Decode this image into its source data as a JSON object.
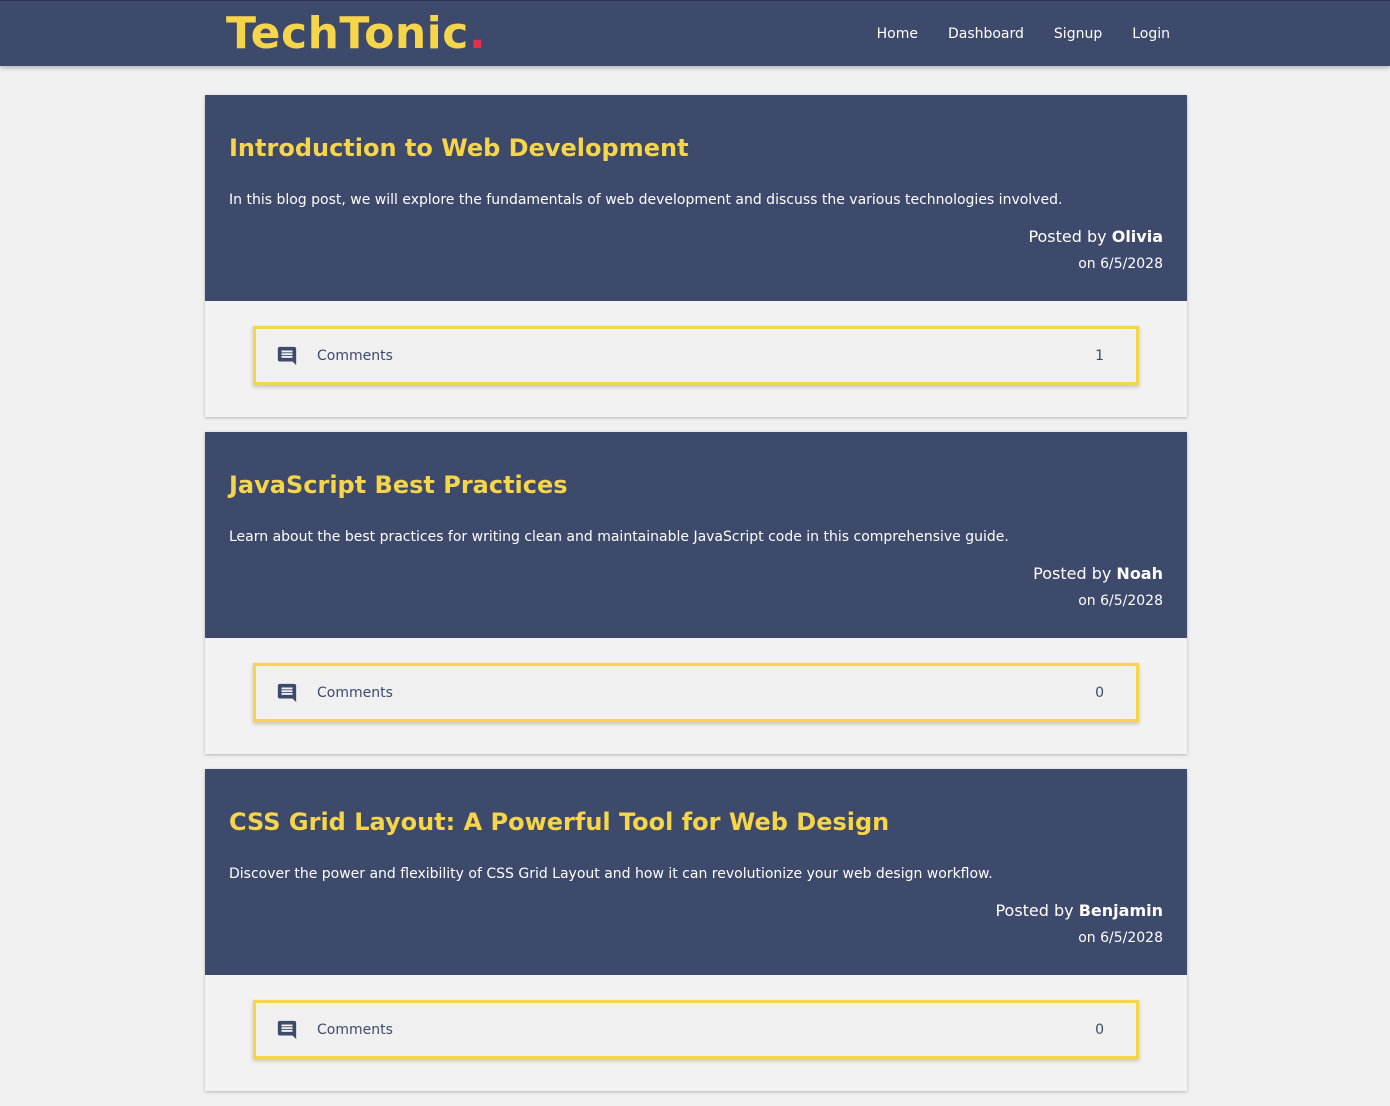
{
  "brand": {
    "name": "TechTonic",
    "dot": ".",
    "color": "#f7d54a",
    "dot_color": "#e2314b"
  },
  "nav": {
    "links": [
      {
        "label": "Home"
      },
      {
        "label": "Dashboard"
      },
      {
        "label": "Signup"
      },
      {
        "label": "Login"
      }
    ]
  },
  "posts": [
    {
      "title": "Introduction to Web Development",
      "body": "In this blog post, we will explore the fundamentals of web development and discuss the various technologies involved.",
      "posted_by_prefix": "Posted by",
      "author": "Olivia",
      "date": "on 6/5/2028",
      "comments_label": "Comments",
      "comments_count": "1",
      "comments_icon": "comment-icon"
    },
    {
      "title": "JavaScript Best Practices",
      "body": "Learn about the best practices for writing clean and maintainable JavaScript code in this comprehensive guide.",
      "posted_by_prefix": "Posted by",
      "author": "Noah",
      "date": "on 6/5/2028",
      "comments_label": "Comments",
      "comments_count": "0",
      "comments_icon": "comment-icon"
    },
    {
      "title": "CSS Grid Layout: A Powerful Tool for Web Design",
      "body": "Discover the power and flexibility of CSS Grid Layout and how it can revolutionize your web design workflow.",
      "posted_by_prefix": "Posted by",
      "author": "Benjamin",
      "date": "on 6/5/2028",
      "comments_label": "Comments",
      "comments_count": "0",
      "comments_icon": "comment-icon"
    }
  ],
  "colors": {
    "navbar": "#3d4a6b",
    "accent": "#f7d54a",
    "background": "#f0f0f0"
  }
}
